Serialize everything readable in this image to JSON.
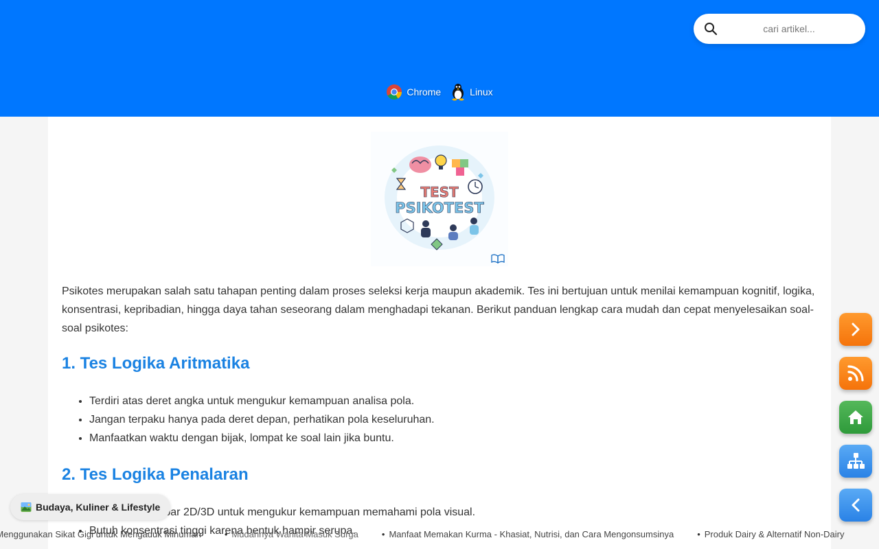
{
  "header": {
    "search": {
      "placeholder": "cari artikel..."
    },
    "platforms": [
      {
        "label": "Chrome",
        "icon": "chrome-icon"
      },
      {
        "label": "Linux",
        "icon": "linux-tux-icon"
      }
    ],
    "colors": {
      "header_bg": "#0077ff"
    }
  },
  "article": {
    "hero": {
      "title_line1": "TEST",
      "title_line2": "PSIKOTEST",
      "icon": "psychotest-illustration"
    },
    "intro": "Psikotes merupakan salah satu tahapan penting dalam proses seleksi kerja maupun akademik. Tes ini bertujuan untuk menilai kemampuan kognitif, logika, konsentrasi, kepribadian, hingga daya tahan seseorang dalam menghadapi tekanan. Berikut panduan lengkap cara mudah dan cepat menyelesaikan soal-soal psikotes:",
    "sections": [
      {
        "heading": "1. Tes Logika Aritmatika",
        "items": [
          "Terdiri atas deret angka untuk mengukur kemampuan analisa pola.",
          "Jangan terpaku hanya pada deret depan, perhatikan pola keseluruhan.",
          "Manfaatkan waktu dengan bijak, lompat ke soal lain jika buntu."
        ]
      },
      {
        "heading": "2. Tes Logika Penalaran",
        "items": [
          "Berisi soal gambar 2D/3D untuk mengukur kemampuan memahami pola visual.",
          "Butuh konsentrasi tinggi karena bentuk hampir serupa."
        ]
      }
    ],
    "heading_color": "#1a82e2"
  },
  "floating_buttons": [
    {
      "icon": "chevron-right-icon",
      "color": "#f5730a"
    },
    {
      "icon": "rss-icon",
      "color": "#f5730a"
    },
    {
      "icon": "home-icon",
      "color": "#2e9a3a"
    },
    {
      "icon": "sitemap-icon",
      "color": "#2a82e6"
    },
    {
      "icon": "chevron-left-icon",
      "color": "#2a82e6"
    }
  ],
  "category_pill": {
    "label": "Budaya, Kuliner & Lifestyle",
    "icon": "landscape-picture-icon"
  },
  "ticker": [
    "Cara Menggunakan Sikat Gigi untuk Mengaduk Minuman",
    "Mudahnya Wanita Masuk Surga",
    "Manfaat Memakan Kurma - Khasiat, Nutrisi, dan Cara Mengonsumsinya",
    "Produk Dairy & Alternatif Non-Dairy"
  ]
}
